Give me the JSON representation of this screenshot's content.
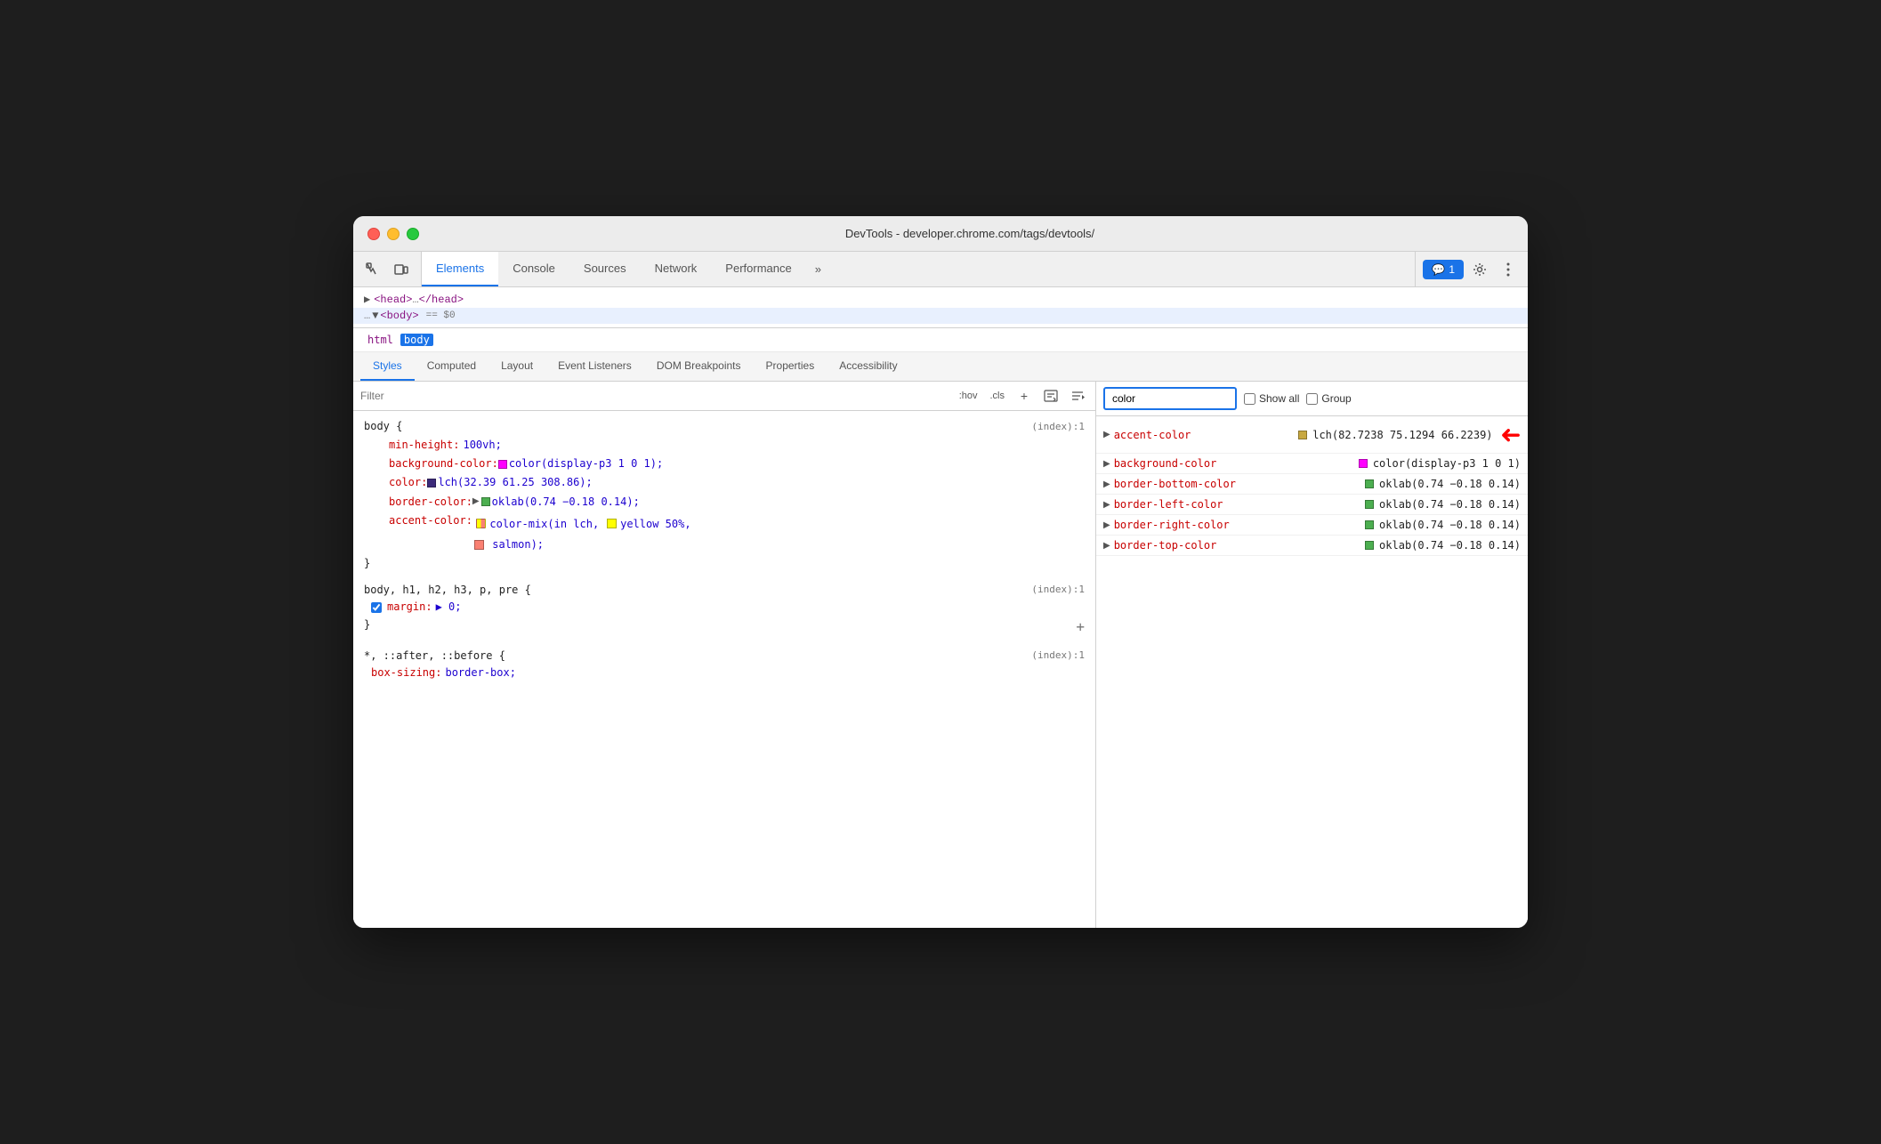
{
  "window": {
    "title": "DevTools - developer.chrome.com/tags/devtools/"
  },
  "toolbar": {
    "tabs": [
      {
        "label": "Elements",
        "active": true
      },
      {
        "label": "Console",
        "active": false
      },
      {
        "label": "Sources",
        "active": false
      },
      {
        "label": "Network",
        "active": false
      },
      {
        "label": "Performance",
        "active": false
      },
      {
        "label": "»",
        "active": false
      }
    ],
    "comment_badge": "1",
    "comment_label": "1"
  },
  "dom": {
    "line1": "<head> … </head>",
    "line2_prefix": "… ▼ ",
    "line2_tag": "<body>",
    "line2_suffix": " == $0"
  },
  "breadcrumbs": [
    {
      "label": "html",
      "active": false
    },
    {
      "label": "body",
      "active": true
    }
  ],
  "sub_tabs": [
    {
      "label": "Styles",
      "active": true
    },
    {
      "label": "Computed",
      "active": false
    },
    {
      "label": "Layout",
      "active": false
    },
    {
      "label": "Event Listeners",
      "active": false
    },
    {
      "label": "DOM Breakpoints",
      "active": false
    },
    {
      "label": "Properties",
      "active": false
    },
    {
      "label": "Accessibility",
      "active": false
    }
  ],
  "filter": {
    "placeholder": "Filter",
    "hov_label": ":hov",
    "cls_label": ".cls"
  },
  "css_rules": [
    {
      "selector": "body {",
      "source": "(index):1",
      "properties": [
        {
          "prop": "min-height:",
          "value": "100vh;",
          "swatch": null,
          "has_checkbox": false,
          "has_arrow": false
        },
        {
          "prop": "background-color:",
          "value": "color(display-p3 1 0 1);",
          "swatch": "magenta",
          "has_checkbox": false,
          "has_arrow": false
        },
        {
          "prop": "color:",
          "value": "lch(32.39 61.25 308.86);",
          "swatch": "purple-dark",
          "has_checkbox": false,
          "has_arrow": false
        },
        {
          "prop": "border-color:",
          "value": "oklab(0.74 -0.18 0.14);",
          "swatch": "green",
          "has_checkbox": false,
          "has_arrow": true
        },
        {
          "prop": "accent-color:",
          "value": "color-mix(in lch, ",
          "swatch": "mix",
          "swatch2": "yellow",
          "value2": "yellow 50%,",
          "value3": "salmon);",
          "has_checkbox": false,
          "has_arrow": false,
          "multiline": true
        }
      ],
      "close": "}"
    },
    {
      "selector": "body, h1, h2, h3, p, pre {",
      "source": "(index):1",
      "properties": [
        {
          "prop": "margin:",
          "value": "▶ 0;",
          "swatch": null,
          "has_checkbox": true,
          "has_arrow": false
        }
      ],
      "close": "}"
    },
    {
      "selector": "*, ::after, ::before {",
      "source": "(index):1",
      "properties": [
        {
          "prop": "box-sizing:",
          "value": "border-box;",
          "swatch": null,
          "has_checkbox": false,
          "has_arrow": false
        }
      ]
    }
  ],
  "computed": {
    "search_value": "color",
    "show_all_label": "Show all",
    "group_label": "Group",
    "items": [
      {
        "prop": "accent-color",
        "swatch": "lch-gold",
        "value": "lch(82.7238 75.1294 66.2239)",
        "has_arrow": true
      },
      {
        "prop": "background-color",
        "swatch": "magenta",
        "value": "color(display-p3 1 0 1)",
        "has_arrow": true
      },
      {
        "prop": "border-bottom-color",
        "swatch": "green2",
        "value": "oklab(0.74 -0.18 0.14)",
        "has_arrow": true
      },
      {
        "prop": "border-left-color",
        "swatch": "green2",
        "value": "oklab(0.74 -0.18 0.14)",
        "has_arrow": true
      },
      {
        "prop": "border-right-color",
        "swatch": "green2",
        "value": "oklab(0.74 -0.18 0.14)",
        "has_arrow": true
      },
      {
        "prop": "border-top-color",
        "swatch": "green2",
        "value": "oklab(0.74 -0.18 0.14)",
        "has_arrow": true
      }
    ]
  }
}
